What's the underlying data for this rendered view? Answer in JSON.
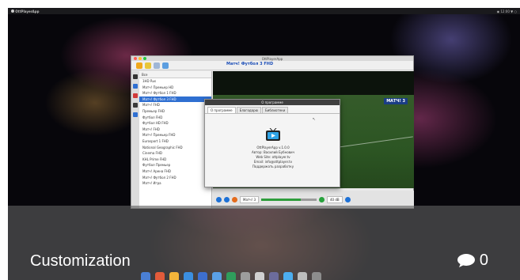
{
  "desktop": {
    "menubar_left": "OttPlayerApp",
    "menubar_right": "◉ 12:00 ▼ ○"
  },
  "app": {
    "title": "OttPlayerApp",
    "now_playing": "Матч! Футбол 3 FHD",
    "channel_list_header": "Все",
    "channels": [
      "1HD Rus",
      "Матч! Премьер HD",
      "Матч! Футбол 1 FHD",
      "Матч! Футбол 3 FHD",
      "Матч! FHD",
      "Премьер FHD",
      "Футбол FHD",
      "Футбол HD FHD",
      "Матч! FHD",
      "Матч! Премьер FHD",
      "Eurosport 1 FHD",
      "National Geographic FHD",
      "Cinema FHD",
      "KHL Prime FHD",
      "Футбол Премьер",
      "Матч! Арена FHD",
      "Матч! Футбол 2 FHD",
      "Матч! Игра"
    ],
    "selected_index": 3,
    "channel_logo": "МАТЧ! 3",
    "status_field": "Матч! 3",
    "volume_label": "40 dB",
    "progress": 0.72
  },
  "about": {
    "title": "О программе",
    "tabs": [
      "О программе",
      "Благодарю",
      "Библиотеки"
    ],
    "version": "OttPlayerApp v.1.0.0",
    "author": "Автор: Василий Бубнович",
    "web": "Web Site: ottplayer.tv",
    "email": "Email: info@ottplayer.tv",
    "support": "Поддержать разработку"
  },
  "card": {
    "category": "Customization",
    "comment_count": "0"
  },
  "colors": {
    "accent": "#2f6fd1",
    "overlay": "#5f5f5f",
    "progress": "#2f9d3c"
  }
}
